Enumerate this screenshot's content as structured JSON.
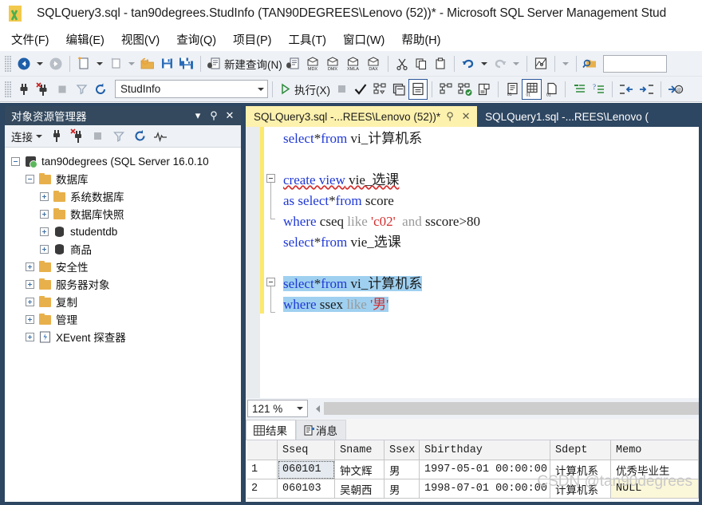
{
  "window": {
    "title": "SQLQuery3.sql - tan90degrees.StudInfo (TAN90DEGREES\\Lenovo (52))* - Microsoft SQL Server Management Stud",
    "logo_icon": "ssms-logo-icon"
  },
  "menubar": {
    "items": [
      {
        "label": "文件(F)",
        "name": "menu-file"
      },
      {
        "label": "编辑(E)",
        "name": "menu-edit"
      },
      {
        "label": "视图(V)",
        "name": "menu-view"
      },
      {
        "label": "查询(Q)",
        "name": "menu-query"
      },
      {
        "label": "项目(P)",
        "name": "menu-project"
      },
      {
        "label": "工具(T)",
        "name": "menu-tools"
      },
      {
        "label": "窗口(W)",
        "name": "menu-window"
      },
      {
        "label": "帮助(H)",
        "name": "menu-help"
      }
    ]
  },
  "toolbar_standard": {
    "new_query_label": "新建查询(N)",
    "icons": [
      "navigate-back-icon",
      "navigate-forward-icon",
      "new-project-icon",
      "new-item-icon",
      "open-file-icon",
      "save-icon",
      "save-all-icon",
      "new-query-icon",
      "new-mdx-query-icon",
      "new-dmx-query-icon",
      "new-xmla-query-icon",
      "new-dax-query-icon",
      "cut-icon",
      "copy-icon",
      "paste-icon",
      "undo-icon",
      "redo-icon",
      "activity-monitor-icon",
      "find-icon"
    ]
  },
  "toolbar_query": {
    "database_value": "StudInfo",
    "execute_label": "执行(X)",
    "icons": [
      "connect-icon",
      "disconnect-icon",
      "stop-icon",
      "parse-check-icon",
      "display-estimated-plan-icon",
      "query-options-icon",
      "include-actual-plan-icon",
      "include-live-plan-icon",
      "include-client-statistics-icon",
      "results-to-text-icon",
      "results-to-grid-icon",
      "results-to-file-icon",
      "comment-lines-icon",
      "uncomment-lines-icon",
      "decrease-indent-icon",
      "increase-indent-icon",
      "specify-values-icon"
    ]
  },
  "object_explorer": {
    "title": "对象资源管理器",
    "window_controls": [
      "dropdown-icon",
      "pin-icon",
      "close-icon"
    ],
    "toolbar": {
      "connect_label": "连接",
      "icons": [
        "connect-plug-icon",
        "disconnect-plug-icon",
        "stop-icon",
        "filter-icon",
        "refresh-icon",
        "activity-monitor-icon"
      ]
    },
    "tree": [
      {
        "label": "tan90degrees (SQL Server 16.0.10",
        "depth": 0,
        "icon": "server-icon",
        "state": "expanded"
      },
      {
        "label": "数据库",
        "depth": 1,
        "icon": "folder-icon",
        "state": "expanded"
      },
      {
        "label": "系统数据库",
        "depth": 2,
        "icon": "folder-icon",
        "state": "collapsed"
      },
      {
        "label": "数据库快照",
        "depth": 2,
        "icon": "folder-icon",
        "state": "collapsed"
      },
      {
        "label": "studentdb",
        "depth": 2,
        "icon": "database-icon",
        "state": "collapsed"
      },
      {
        "label": "商品",
        "depth": 2,
        "icon": "database-icon",
        "state": "collapsed"
      },
      {
        "label": "安全性",
        "depth": 1,
        "icon": "folder-icon",
        "state": "collapsed"
      },
      {
        "label": "服务器对象",
        "depth": 1,
        "icon": "folder-icon",
        "state": "collapsed"
      },
      {
        "label": "复制",
        "depth": 1,
        "icon": "folder-icon",
        "state": "collapsed"
      },
      {
        "label": "管理",
        "depth": 1,
        "icon": "folder-icon",
        "state": "collapsed"
      },
      {
        "label": "XEvent 探查器",
        "depth": 1,
        "icon": "xevent-icon",
        "state": "collapsed"
      }
    ]
  },
  "document_tabs": [
    {
      "label": "SQLQuery3.sql -...REES\\Lenovo (52))*",
      "active": true,
      "pin_icon": "pin-icon",
      "close_icon": "close-icon"
    },
    {
      "label": "SQLQuery1.sql -...REES\\Lenovo (",
      "active": false
    }
  ],
  "editor": {
    "lines": [
      {
        "segments": [
          {
            "t": "select",
            "c": "kw"
          },
          {
            "t": "*",
            "c": "plain"
          },
          {
            "t": "from",
            "c": "kw"
          },
          {
            "t": " vi_计算机系",
            "c": "plain"
          }
        ],
        "selected": false,
        "outline": "none"
      },
      {
        "segments": [],
        "selected": false,
        "outline": "none"
      },
      {
        "segments": [
          {
            "t": "create view",
            "c": "kw squig"
          },
          {
            "t": " vie_选课",
            "c": "plain squig"
          }
        ],
        "selected": false,
        "outline": "start"
      },
      {
        "segments": [
          {
            "t": "as ",
            "c": "kw"
          },
          {
            "t": "select",
            "c": "kw"
          },
          {
            "t": "*",
            "c": "plain"
          },
          {
            "t": "from",
            "c": "kw"
          },
          {
            "t": " score",
            "c": "plain"
          }
        ],
        "selected": false,
        "outline": "mid"
      },
      {
        "segments": [
          {
            "t": "where",
            "c": "kw"
          },
          {
            "t": " cseq ",
            "c": "plain"
          },
          {
            "t": "like",
            "c": "gray"
          },
          {
            "t": " ",
            "c": "plain"
          },
          {
            "t": "'c02'",
            "c": "str"
          },
          {
            "t": "  ",
            "c": "plain"
          },
          {
            "t": "and",
            "c": "gray"
          },
          {
            "t": " sscore",
            "c": "plain"
          },
          {
            "t": ">",
            "c": "plain"
          },
          {
            "t": "80",
            "c": "plain"
          }
        ],
        "selected": false,
        "outline": "end"
      },
      {
        "segments": [
          {
            "t": "select",
            "c": "kw"
          },
          {
            "t": "*",
            "c": "plain"
          },
          {
            "t": "from",
            "c": "kw"
          },
          {
            "t": " vie_选课",
            "c": "plain"
          }
        ],
        "selected": false,
        "outline": "none"
      },
      {
        "segments": [],
        "selected": false,
        "outline": "none"
      },
      {
        "segments": [
          {
            "t": "select",
            "c": "kw"
          },
          {
            "t": "*",
            "c": "plain"
          },
          {
            "t": "from",
            "c": "kw"
          },
          {
            "t": " vi_计算机系",
            "c": "plain"
          }
        ],
        "selected": true,
        "outline": "start"
      },
      {
        "segments": [
          {
            "t": "where",
            "c": "kw"
          },
          {
            "t": " ssex ",
            "c": "plain"
          },
          {
            "t": "like",
            "c": "gray"
          },
          {
            "t": " ",
            "c": "plain"
          },
          {
            "t": "'男'",
            "c": "str"
          }
        ],
        "selected": true,
        "outline": "end"
      }
    ]
  },
  "zoombar": {
    "zoom_value": "121 %",
    "scroll_left_icon": "scroll-left-arrow-icon"
  },
  "results_tabs": [
    {
      "label": "结果",
      "icon": "grid-results-icon",
      "active": true
    },
    {
      "label": "消息",
      "icon": "messages-icon",
      "active": false
    }
  ],
  "results_grid": {
    "columns": [
      "",
      "Sseq",
      "Sname",
      "Ssex",
      "Sbirthday",
      "Sdept",
      "Memo"
    ],
    "rows": [
      {
        "num": "1",
        "Sseq": "060101",
        "Sname": "钟文辉",
        "Ssex": "男",
        "Sbirthday": "1997-05-01 00:00:00",
        "Sdept": "计算机系",
        "Memo": "优秀毕业生",
        "memo_is_null": false,
        "selected_cell": "Sseq"
      },
      {
        "num": "2",
        "Sseq": "060103",
        "Sname": "吴朝西",
        "Ssex": "男",
        "Sbirthday": "1998-07-01 00:00:00",
        "Sdept": "计算机系",
        "Memo": "NULL",
        "memo_is_null": true,
        "selected_cell": ""
      }
    ]
  },
  "watermark": {
    "text": "CSDN @tan90degrees"
  },
  "colors": {
    "chrome_dark": "#2d4661",
    "oe_title": "#34495e",
    "active_tab": "#fdf1ae",
    "toolbar_bg": "#eef1f5",
    "keyword": "#1f38d6",
    "string": "#d42e2e",
    "selection": "#9fd0f0",
    "change_bar": "#fbe96c",
    "null_cell": "#fbf7d9"
  }
}
